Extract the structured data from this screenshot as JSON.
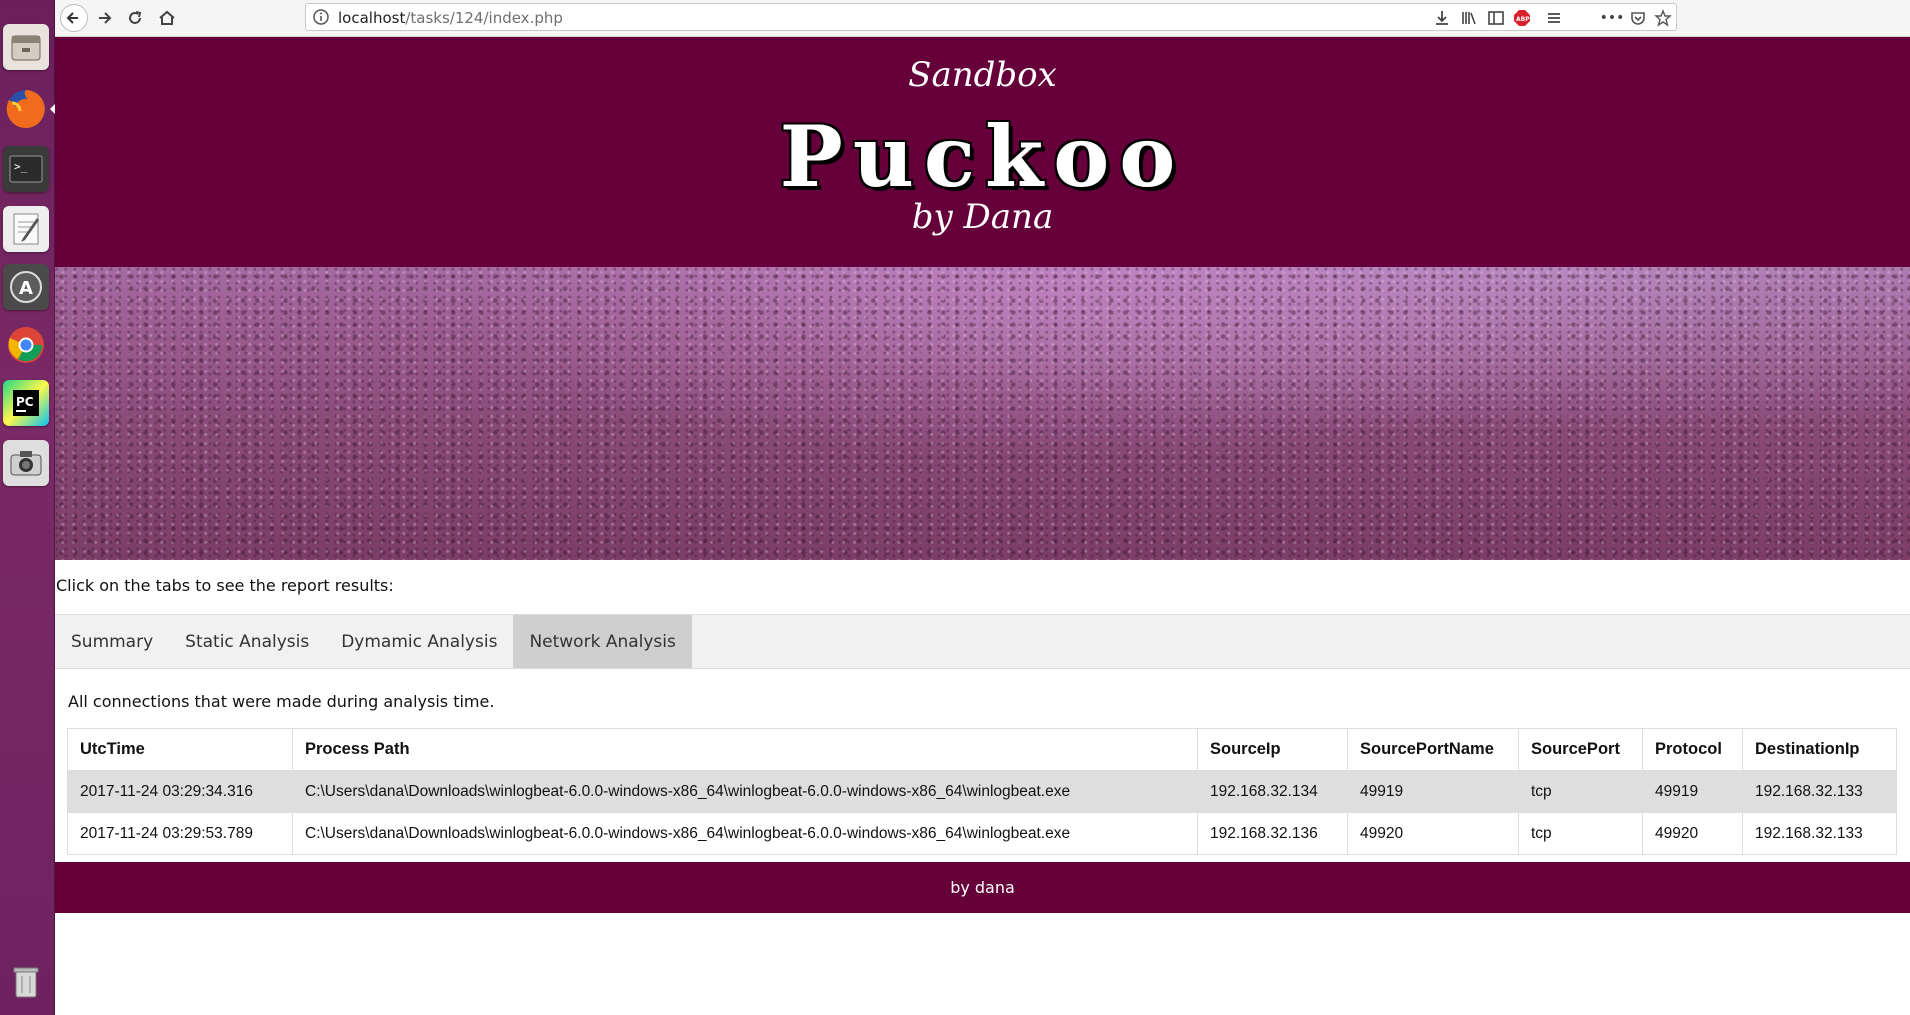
{
  "browser": {
    "url_host": "localhost",
    "url_path": "/tasks/124/index.php"
  },
  "header": {
    "top_text": "Sandbox",
    "title": "Puckoo",
    "bottom_text": "by Dana",
    "bg_color": "#66003a"
  },
  "intro_text": "Click on the tabs to see the report results:",
  "tabs": [
    {
      "label": "Summary"
    },
    {
      "label": "Static Analysis"
    },
    {
      "label": "Dymamic Analysis"
    },
    {
      "label": "Network Analysis",
      "active": true
    }
  ],
  "network": {
    "description": "All connections that were made during analysis time.",
    "columns": [
      "UtcTime",
      "Process Path",
      "SourceIp",
      "SourcePortName",
      "SourcePort",
      "Protocol",
      "DestinationIp"
    ],
    "rows": [
      [
        "2017-11-24 03:29:34.316",
        "C:\\Users\\dana\\Downloads\\winlogbeat-6.0.0-windows-x86_64\\winlogbeat-6.0.0-windows-x86_64\\winlogbeat.exe",
        "192.168.32.134",
        "49919",
        "tcp",
        "49919",
        "192.168.32.133"
      ],
      [
        "2017-11-24 03:29:53.789",
        "C:\\Users\\dana\\Downloads\\winlogbeat-6.0.0-windows-x86_64\\winlogbeat-6.0.0-windows-x86_64\\winlogbeat.exe",
        "192.168.32.136",
        "49920",
        "tcp",
        "49920",
        "192.168.32.133"
      ]
    ]
  },
  "footer_text": "by dana"
}
